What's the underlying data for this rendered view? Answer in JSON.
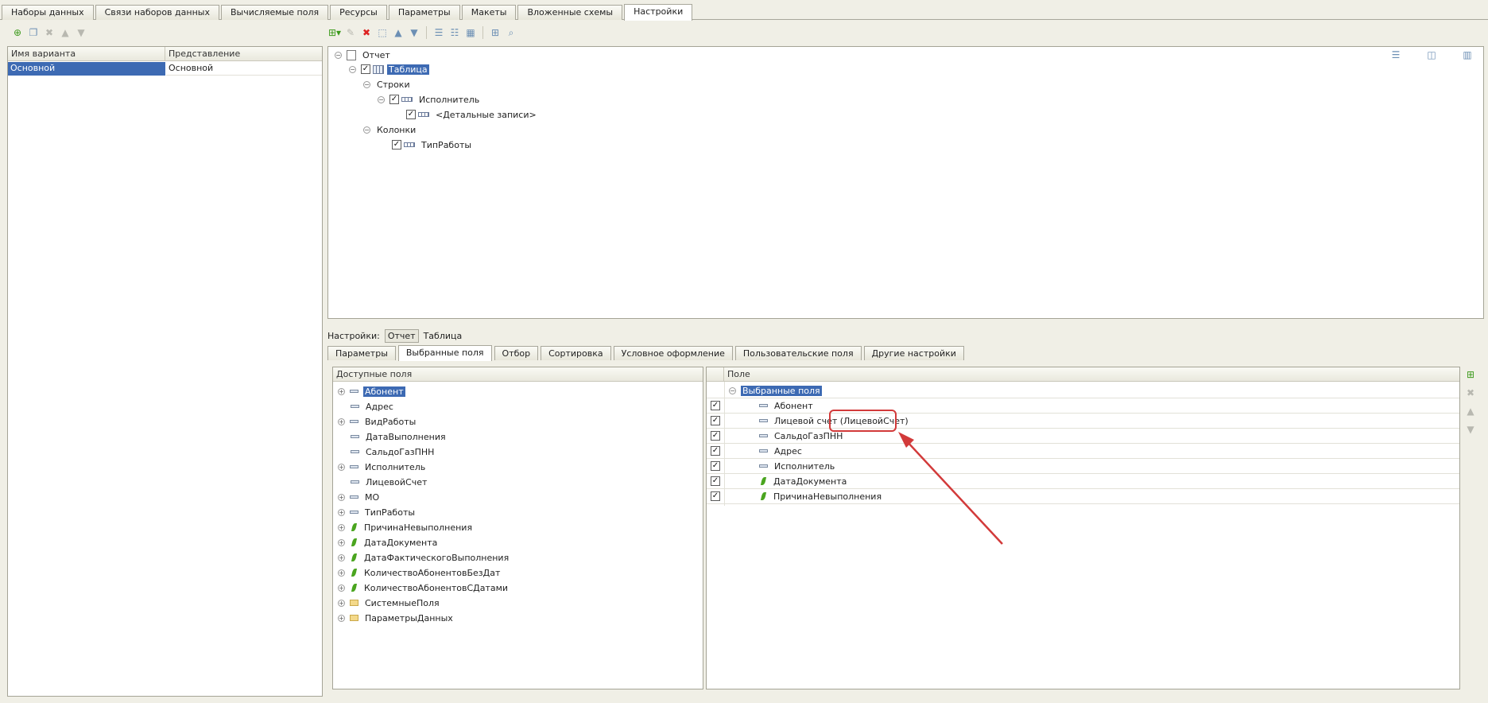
{
  "top_tabs": [
    {
      "label": "Наборы данных",
      "active": false
    },
    {
      "label": "Связи наборов данных",
      "active": false
    },
    {
      "label": "Вычисляемые поля",
      "active": false
    },
    {
      "label": "Ресурсы",
      "active": false
    },
    {
      "label": "Параметры",
      "active": false
    },
    {
      "label": "Макеты",
      "active": false
    },
    {
      "label": "Вложенные схемы",
      "active": false
    },
    {
      "label": "Настройки",
      "active": true
    }
  ],
  "variants": {
    "columns": [
      "Имя варианта",
      "Представление"
    ],
    "rows": [
      {
        "name": "Основной",
        "presentation": "Основной",
        "selected": true
      }
    ]
  },
  "structure": {
    "root": "Отчет",
    "table": "Таблица",
    "rows_group": "Строки",
    "executor": "Исполнитель",
    "detail": "<Детальные записи>",
    "columns_group": "Колонки",
    "work_type": "ТипРаботы"
  },
  "settings_bar": {
    "label": "Настройки:",
    "report_button": "Отчет",
    "table_label": "Таблица"
  },
  "sub_tabs": [
    {
      "label": "Параметры",
      "active": false
    },
    {
      "label": "Выбранные поля",
      "active": true
    },
    {
      "label": "Отбор",
      "active": false
    },
    {
      "label": "Сортировка",
      "active": false
    },
    {
      "label": "Условное оформление",
      "active": false
    },
    {
      "label": "Пользовательские поля",
      "active": false
    },
    {
      "label": "Другие настройки",
      "active": false
    }
  ],
  "available_fields": {
    "header": "Доступные поля",
    "items": [
      {
        "label": "Абонент",
        "expandable": true,
        "icon": "field-icon",
        "selected": true
      },
      {
        "label": "Адрес",
        "expandable": false,
        "icon": "field-icon"
      },
      {
        "label": "ВидРаботы",
        "expandable": true,
        "icon": "field-icon"
      },
      {
        "label": "ДатаВыполнения",
        "expandable": false,
        "icon": "field-icon"
      },
      {
        "label": "СальдоГазПНН",
        "expandable": false,
        "icon": "field-icon"
      },
      {
        "label": "Исполнитель",
        "expandable": true,
        "icon": "field-icon"
      },
      {
        "label": "ЛицевойСчет",
        "expandable": false,
        "icon": "field-icon"
      },
      {
        "label": "МО",
        "expandable": true,
        "icon": "field-icon"
      },
      {
        "label": "ТипРаботы",
        "expandable": true,
        "icon": "field-icon"
      },
      {
        "label": "ПричинаНевыполнения",
        "expandable": true,
        "icon": "resource-icon"
      },
      {
        "label": "ДатаДокумента",
        "expandable": true,
        "icon": "resource-icon"
      },
      {
        "label": "ДатаФактическогоВыполнения",
        "expandable": true,
        "icon": "resource-icon"
      },
      {
        "label": "КоличествоАбонентовБезДат",
        "expandable": true,
        "icon": "resource-icon"
      },
      {
        "label": "КоличествоАбонентовСДатами",
        "expandable": true,
        "icon": "resource-icon"
      },
      {
        "label": "СистемныеПоля",
        "expandable": true,
        "icon": "folder-icon"
      },
      {
        "label": "ПараметрыДанных",
        "expandable": true,
        "icon": "folder-icon"
      }
    ]
  },
  "selected_fields": {
    "header": "Поле",
    "group": "Выбранные поля",
    "items": [
      {
        "label": "Абонент",
        "checked": true,
        "icon": "field-icon"
      },
      {
        "label": "Лицевой счет (ЛицевойСчет)",
        "checked": true,
        "icon": "field-icon"
      },
      {
        "label": "СальдоГазПНН",
        "checked": true,
        "icon": "field-icon"
      },
      {
        "label": "Адрес",
        "checked": true,
        "icon": "field-icon"
      },
      {
        "label": "Исполнитель",
        "checked": true,
        "icon": "field-icon"
      },
      {
        "label": "ДатаДокумента",
        "checked": true,
        "icon": "resource-icon"
      },
      {
        "label": "ПричинаНевыполнения",
        "checked": true,
        "icon": "resource-icon"
      }
    ]
  },
  "colors": {
    "selection": "#3d6ab3",
    "annotation": "#d23a3a",
    "resource_icon": "#4aa51f"
  }
}
